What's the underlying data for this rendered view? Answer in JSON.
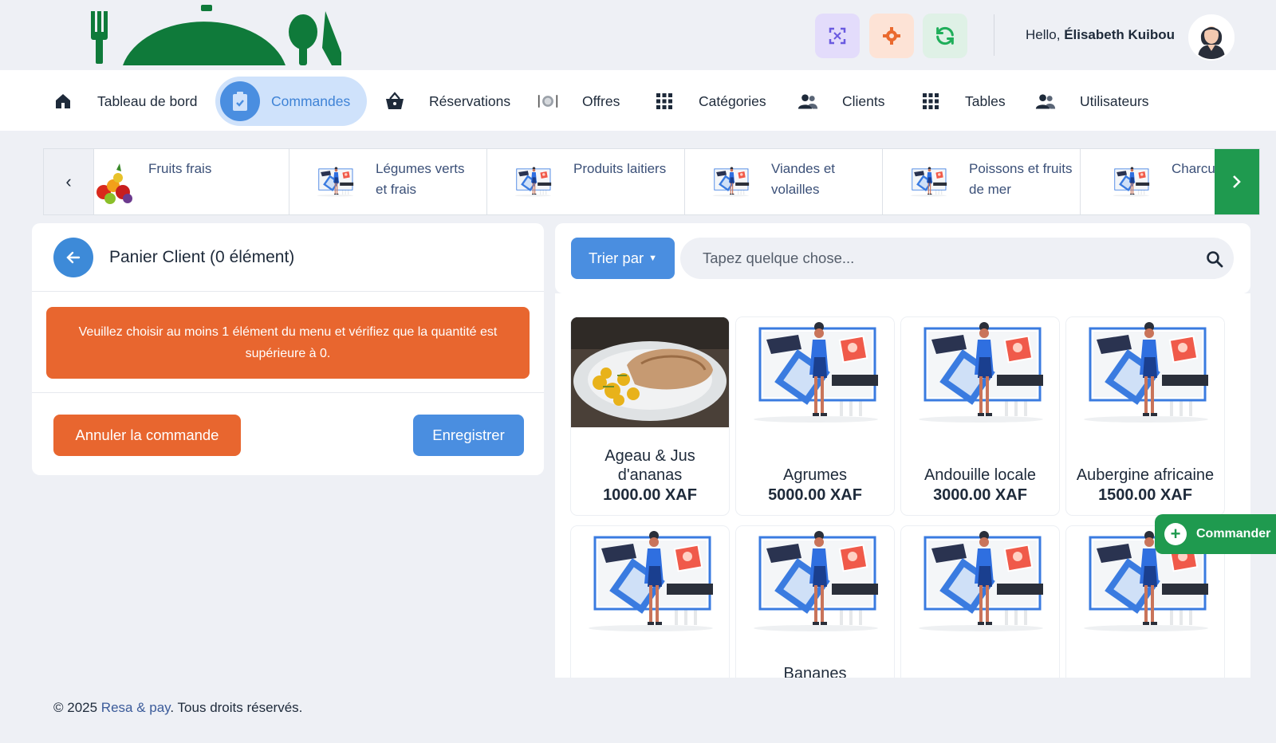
{
  "header": {
    "hello_prefix": "Hello, ",
    "user_name": "Élisabeth Kuibou",
    "brand_color": "#0f7a3a"
  },
  "nav": {
    "items": [
      {
        "label": "Tableau de bord",
        "icon": "home-icon"
      },
      {
        "label": "Commandes",
        "icon": "clipboard-check-icon",
        "active": true
      },
      {
        "label": "Réservations",
        "icon": "basket-icon"
      },
      {
        "label": "Offres",
        "icon": "plate-cutlery-icon"
      },
      {
        "label": "Catégories",
        "icon": "grid-icon"
      },
      {
        "label": "Clients",
        "icon": "users-icon"
      },
      {
        "label": "Tables",
        "icon": "grid-icon"
      },
      {
        "label": "Utilisateurs",
        "icon": "users-icon"
      }
    ]
  },
  "categories": {
    "items": [
      {
        "label": "Fruits frais",
        "icon": "fruits-photo"
      },
      {
        "label": "Légumes verts et frais",
        "icon": "placeholder-illustration"
      },
      {
        "label": "Produits laitiers",
        "icon": "placeholder-illustration"
      },
      {
        "label": "Viandes et volailles",
        "icon": "placeholder-illustration"
      },
      {
        "label": "Poissons et fruits de mer",
        "icon": "placeholder-illustration"
      },
      {
        "label": "Charcut",
        "icon": "placeholder-illustration"
      }
    ]
  },
  "cart": {
    "title": "Panier Client (0 élément)",
    "alert": "Veuillez choisir au moins 1 élément du menu et vérifiez que la quantité est supérieure à 0.",
    "cancel_label": "Annuler la commande",
    "save_label": "Enregistrer"
  },
  "search": {
    "sort_label": "Trier par",
    "placeholder": "Tapez quelque chose..."
  },
  "products": [
    {
      "name": "Ageau & Jus d'ananas",
      "price": "1000.00 XAF",
      "image": "food-photo"
    },
    {
      "name": "Agrumes",
      "price": "5000.00 XAF",
      "image": "placeholder-illustration"
    },
    {
      "name": "Andouille locale",
      "price": "3000.00 XAF",
      "image": "placeholder-illustration"
    },
    {
      "name": "Aubergine africaine",
      "price": "1500.00 XAF",
      "image": "placeholder-illustration"
    },
    {
      "name": "",
      "price": "",
      "image": "placeholder-illustration"
    },
    {
      "name": "Bananes",
      "price": "",
      "image": "placeholder-illustration"
    },
    {
      "name": "",
      "price": "",
      "image": "placeholder-illustration"
    },
    {
      "name": "",
      "price": "",
      "image": "placeholder-illustration"
    }
  ],
  "floating": {
    "order_label": "Commander"
  },
  "footer": {
    "prefix": "© 2025 ",
    "brand": "Resa & pay",
    "suffix": ". Tous droits réservés."
  }
}
